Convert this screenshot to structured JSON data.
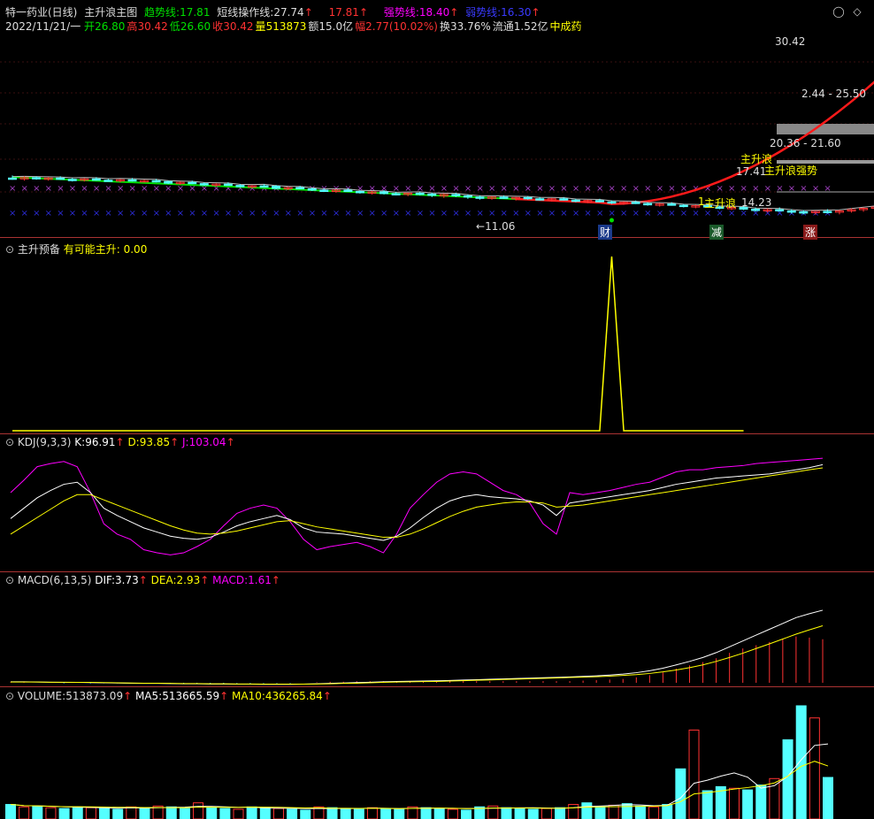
{
  "window": {
    "title": "特一药业(日线)",
    "indicator_name": "主升浪主图",
    "trend_label": "趋势线:",
    "trend_value": "17.81",
    "short_label": "短线操作线:",
    "short_value": "27.74",
    "short_value2": "17.81",
    "strong_label": "强势线:",
    "strong_value": "18.40",
    "weak_label": "弱势线:",
    "weak_value": "16.30",
    "arrow": "↑"
  },
  "quote": {
    "date": "2022/11/21/一",
    "open_label": "开",
    "open": "26.80",
    "high_label": "高",
    "high": "30.42",
    "low_label": "低",
    "low": "26.60",
    "close_label": "收",
    "close": "30.42",
    "volume_label": "量",
    "volume": "513873",
    "amount_label": "额",
    "amount": "15.0亿",
    "change_label": "幅",
    "change": "2.77(10.02%)",
    "turnover_label": "换",
    "turnover": "33.76%",
    "float_label": "流通",
    "float_value": "1.52亿",
    "sector": "中成药"
  },
  "main_annotations": {
    "high_price": "30.42",
    "low_price": "11.06",
    "low_arrow": "←",
    "range1": "2.44 - 25.50",
    "range2": "20.36 - 21.60",
    "price_1741": "17.41",
    "price_1423": "14.23",
    "label_zsl": "主升浪",
    "label_zsl2": "主升浪",
    "label_strong": "主升浪强势",
    "digit_1": "1",
    "tag_cai": "财",
    "tag_jian": "减",
    "tag_zhang": "涨"
  },
  "panel2": {
    "title": "主升预备",
    "label": "有可能主升:",
    "value": "0.00"
  },
  "panel3": {
    "title": "KDJ(9,3,3)",
    "k_label": "K:",
    "k_value": "96.91",
    "d_label": "D:",
    "d_value": "93.85",
    "j_label": "J:",
    "j_value": "103.04"
  },
  "panel4": {
    "title": "MACD(6,13,5)",
    "dif_label": "DIF:",
    "dif_value": "3.73",
    "dea_label": "DEA:",
    "dea_value": "2.93",
    "macd_label": "MACD:",
    "macd_value": "1.61"
  },
  "panel5": {
    "title": "VOLUME:",
    "vol_value": "513873.09",
    "ma5_label": "MA5:",
    "ma5_value": "513665.59",
    "ma10_label": "MA10:",
    "ma10_value": "436265.84"
  },
  "colors": {
    "up": "#ff3232",
    "down": "#54ffff",
    "magenta": "#ff00ff",
    "yellow": "#ffff00",
    "green": "#00e000",
    "trend_red": "#ff1a1a",
    "blue_x": "#2b2bd6",
    "purple_x": "#a040c0",
    "white": "#ffffff",
    "separator": "#aa3333"
  },
  "chart_data": {
    "type": "candlestick",
    "note_icons": [
      "minimize-icon",
      "maximize-icon"
    ],
    "candles": [
      {
        "o": 15.3,
        "h": 15.6,
        "l": 15.1,
        "c": 15.25
      },
      {
        "o": 15.25,
        "h": 15.5,
        "l": 15.0,
        "c": 15.35
      },
      {
        "o": 15.35,
        "h": 15.5,
        "l": 15.1,
        "c": 15.2
      },
      {
        "o": 15.2,
        "h": 15.4,
        "l": 15.0,
        "c": 15.3
      },
      {
        "o": 15.3,
        "h": 15.5,
        "l": 15.1,
        "c": 15.15
      },
      {
        "o": 15.15,
        "h": 15.3,
        "l": 14.9,
        "c": 15.1
      },
      {
        "o": 15.1,
        "h": 15.3,
        "l": 14.9,
        "c": 15.2
      },
      {
        "o": 15.2,
        "h": 15.4,
        "l": 15.0,
        "c": 15.05
      },
      {
        "o": 15.05,
        "h": 15.2,
        "l": 14.9,
        "c": 15.0
      },
      {
        "o": 15.0,
        "h": 15.2,
        "l": 14.8,
        "c": 15.1
      },
      {
        "o": 15.1,
        "h": 15.3,
        "l": 14.9,
        "c": 14.95
      },
      {
        "o": 14.95,
        "h": 15.1,
        "l": 14.8,
        "c": 15.0
      },
      {
        "o": 15.0,
        "h": 15.2,
        "l": 14.8,
        "c": 14.9
      },
      {
        "o": 14.9,
        "h": 15.0,
        "l": 14.6,
        "c": 14.7
      },
      {
        "o": 14.7,
        "h": 14.9,
        "l": 14.5,
        "c": 14.8
      },
      {
        "o": 14.8,
        "h": 15.0,
        "l": 14.6,
        "c": 14.65
      },
      {
        "o": 14.65,
        "h": 14.8,
        "l": 14.4,
        "c": 14.5
      },
      {
        "o": 14.5,
        "h": 14.7,
        "l": 14.3,
        "c": 14.6
      },
      {
        "o": 14.6,
        "h": 14.8,
        "l": 14.4,
        "c": 14.45
      },
      {
        "o": 14.45,
        "h": 14.6,
        "l": 14.2,
        "c": 14.3
      },
      {
        "o": 14.3,
        "h": 14.5,
        "l": 14.1,
        "c": 14.4
      },
      {
        "o": 14.4,
        "h": 14.6,
        "l": 14.2,
        "c": 14.35
      },
      {
        "o": 14.35,
        "h": 14.5,
        "l": 14.0,
        "c": 14.1
      },
      {
        "o": 14.1,
        "h": 14.3,
        "l": 13.9,
        "c": 14.2
      },
      {
        "o": 14.2,
        "h": 14.4,
        "l": 14.0,
        "c": 14.05
      },
      {
        "o": 14.05,
        "h": 14.2,
        "l": 13.8,
        "c": 13.9
      },
      {
        "o": 13.9,
        "h": 14.1,
        "l": 13.7,
        "c": 13.8
      },
      {
        "o": 13.8,
        "h": 14.0,
        "l": 13.6,
        "c": 13.9
      },
      {
        "o": 13.9,
        "h": 14.1,
        "l": 13.7,
        "c": 13.75
      },
      {
        "o": 13.75,
        "h": 13.9,
        "l": 13.5,
        "c": 13.6
      },
      {
        "o": 13.6,
        "h": 13.8,
        "l": 13.4,
        "c": 13.7
      },
      {
        "o": 13.7,
        "h": 13.9,
        "l": 13.4,
        "c": 13.5
      },
      {
        "o": 13.5,
        "h": 13.7,
        "l": 13.3,
        "c": 13.4
      },
      {
        "o": 13.4,
        "h": 13.6,
        "l": 13.2,
        "c": 13.55
      },
      {
        "o": 13.55,
        "h": 13.7,
        "l": 13.3,
        "c": 13.45
      },
      {
        "o": 13.45,
        "h": 13.6,
        "l": 13.1,
        "c": 13.3
      },
      {
        "o": 13.3,
        "h": 13.5,
        "l": 13.0,
        "c": 13.4
      },
      {
        "o": 13.4,
        "h": 13.6,
        "l": 13.1,
        "c": 13.25
      },
      {
        "o": 13.25,
        "h": 13.4,
        "l": 12.9,
        "c": 13.1
      },
      {
        "o": 13.1,
        "h": 13.3,
        "l": 12.8,
        "c": 13.0
      },
      {
        "o": 13.0,
        "h": 13.2,
        "l": 12.8,
        "c": 13.1
      },
      {
        "o": 13.1,
        "h": 13.3,
        "l": 12.9,
        "c": 12.95
      },
      {
        "o": 12.95,
        "h": 13.1,
        "l": 12.7,
        "c": 13.05
      },
      {
        "o": 13.05,
        "h": 13.2,
        "l": 12.8,
        "c": 12.9
      },
      {
        "o": 12.9,
        "h": 13.1,
        "l": 12.7,
        "c": 12.8
      },
      {
        "o": 12.8,
        "h": 13.0,
        "l": 12.6,
        "c": 12.9
      },
      {
        "o": 12.9,
        "h": 13.1,
        "l": 12.7,
        "c": 12.75
      },
      {
        "o": 12.75,
        "h": 12.9,
        "l": 12.5,
        "c": 12.6
      },
      {
        "o": 12.6,
        "h": 12.8,
        "l": 12.4,
        "c": 12.7
      },
      {
        "o": 12.7,
        "h": 12.9,
        "l": 12.5,
        "c": 12.55
      },
      {
        "o": 12.55,
        "h": 12.7,
        "l": 12.3,
        "c": 12.4
      },
      {
        "o": 12.4,
        "h": 12.6,
        "l": 12.2,
        "c": 12.5
      },
      {
        "o": 12.5,
        "h": 12.7,
        "l": 12.3,
        "c": 12.35
      },
      {
        "o": 12.35,
        "h": 12.5,
        "l": 12.1,
        "c": 12.2
      },
      {
        "o": 12.2,
        "h": 12.4,
        "l": 12.0,
        "c": 12.3
      },
      {
        "o": 12.3,
        "h": 12.5,
        "l": 12.1,
        "c": 12.15
      },
      {
        "o": 12.15,
        "h": 12.3,
        "l": 11.9,
        "c": 12.0
      },
      {
        "o": 12.0,
        "h": 12.2,
        "l": 11.8,
        "c": 12.1
      },
      {
        "o": 12.1,
        "h": 12.3,
        "l": 11.9,
        "c": 11.95
      },
      {
        "o": 11.95,
        "h": 12.1,
        "l": 11.7,
        "c": 11.8
      },
      {
        "o": 11.8,
        "h": 12.0,
        "l": 11.6,
        "c": 11.9
      },
      {
        "o": 11.9,
        "h": 12.1,
        "l": 11.6,
        "c": 11.7
      },
      {
        "o": 11.7,
        "h": 11.9,
        "l": 11.4,
        "c": 11.55
      },
      {
        "o": 11.55,
        "h": 11.8,
        "l": 11.3,
        "c": 11.65
      },
      {
        "o": 11.65,
        "h": 11.9,
        "l": 11.4,
        "c": 11.5
      },
      {
        "o": 11.5,
        "h": 11.7,
        "l": 11.2,
        "c": 11.4
      },
      {
        "o": 11.4,
        "h": 11.6,
        "l": 11.1,
        "c": 11.3
      },
      {
        "o": 11.3,
        "h": 11.5,
        "l": 11.06,
        "c": 11.45
      },
      {
        "o": 11.45,
        "h": 11.7,
        "l": 11.2,
        "c": 11.35
      },
      {
        "o": 11.35,
        "h": 11.6,
        "l": 11.1,
        "c": 11.5
      },
      {
        "o": 11.5,
        "h": 11.8,
        "l": 11.3,
        "c": 11.65
      },
      {
        "o": 11.65,
        "h": 11.9,
        "l": 11.4,
        "c": 11.8
      },
      {
        "o": 11.8,
        "h": 12.1,
        "l": 11.6,
        "c": 11.95
      },
      {
        "o": 11.95,
        "h": 12.2,
        "l": 11.7,
        "c": 12.1
      },
      {
        "o": 12.1,
        "h": 12.3,
        "l": 11.9,
        "c": 12.2
      },
      {
        "o": 12.2,
        "h": 12.4,
        "l": 12.0,
        "c": 12.3
      },
      {
        "o": 12.3,
        "h": 12.5,
        "l": 12.1,
        "c": 12.25
      },
      {
        "o": 12.25,
        "h": 12.4,
        "l": 12.0,
        "c": 12.35
      },
      {
        "o": 12.35,
        "h": 12.6,
        "l": 12.1,
        "c": 12.5
      },
      {
        "o": 12.5,
        "h": 12.7,
        "l": 12.3,
        "c": 12.45
      },
      {
        "o": 12.45,
        "h": 12.6,
        "l": 12.2,
        "c": 12.35
      },
      {
        "o": 12.35,
        "h": 12.5,
        "l": 12.1,
        "c": 12.4
      },
      {
        "o": 12.4,
        "h": 12.6,
        "l": 12.2,
        "c": 12.3
      },
      {
        "o": 12.3,
        "h": 12.5,
        "l": 12.1,
        "c": 12.45
      },
      {
        "o": 12.45,
        "h": 12.6,
        "l": 12.2,
        "c": 12.3
      },
      {
        "o": 12.3,
        "h": 12.4,
        "l": 12.0,
        "c": 12.2
      },
      {
        "o": 12.2,
        "h": 13.4,
        "l": 12.1,
        "c": 13.35
      },
      {
        "o": 13.35,
        "h": 13.6,
        "l": 13.0,
        "c": 13.2
      },
      {
        "o": 13.2,
        "h": 13.5,
        "l": 13.0,
        "c": 13.4
      },
      {
        "o": 13.4,
        "h": 13.6,
        "l": 13.1,
        "c": 13.3
      },
      {
        "o": 13.3,
        "h": 13.6,
        "l": 13.1,
        "c": 13.55
      },
      {
        "o": 13.55,
        "h": 13.8,
        "l": 13.3,
        "c": 13.65
      },
      {
        "o": 13.65,
        "h": 13.9,
        "l": 13.4,
        "c": 13.8
      },
      {
        "o": 13.8,
        "h": 14.0,
        "l": 13.6,
        "c": 13.95
      },
      {
        "o": 13.95,
        "h": 14.2,
        "l": 13.7,
        "c": 14.1
      },
      {
        "o": 14.1,
        "h": 14.4,
        "l": 13.9,
        "c": 14.3
      },
      {
        "o": 14.3,
        "h": 14.5,
        "l": 14.0,
        "c": 14.45
      },
      {
        "o": 14.45,
        "h": 14.7,
        "l": 14.2,
        "c": 14.6
      },
      {
        "o": 14.6,
        "h": 15.8,
        "l": 14.5,
        "c": 15.7
      },
      {
        "o": 15.7,
        "h": 16.2,
        "l": 15.4,
        "c": 16.0
      },
      {
        "o": 16.0,
        "h": 17.5,
        "l": 15.9,
        "c": 17.41
      },
      {
        "o": 17.41,
        "h": 19.2,
        "l": 17.3,
        "c": 19.1
      },
      {
        "o": 19.1,
        "h": 21.3,
        "l": 18.9,
        "c": 21.0
      },
      {
        "o": 21.0,
        "h": 21.9,
        "l": 19.0,
        "c": 19.3
      },
      {
        "o": 19.3,
        "h": 21.2,
        "l": 19.2,
        "c": 20.9
      },
      {
        "o": 20.9,
        "h": 23.2,
        "l": 20.36,
        "c": 22.8
      },
      {
        "o": 22.8,
        "h": 24.6,
        "l": 22.3,
        "c": 23.4
      },
      {
        "o": 23.4,
        "h": 25.3,
        "l": 22.6,
        "c": 24.9
      },
      {
        "o": 24.9,
        "h": 25.6,
        "l": 23.0,
        "c": 23.8
      },
      {
        "o": 25.5,
        "h": 27.8,
        "l": 25.3,
        "c": 27.65
      },
      {
        "o": 26.8,
        "h": 30.42,
        "l": 26.6,
        "c": 30.42
      }
    ],
    "price_range": [
      9.5,
      32.0
    ],
    "kdj": {
      "K": [
        45,
        55,
        65,
        72,
        78,
        80,
        70,
        55,
        48,
        42,
        36,
        32,
        28,
        26,
        25,
        27,
        32,
        38,
        42,
        45,
        48,
        44,
        36,
        32,
        31,
        30,
        28,
        26,
        24,
        28,
        36,
        46,
        55,
        62,
        66,
        68,
        66,
        65,
        64,
        62,
        58,
        48,
        60,
        62,
        64,
        66,
        68,
        70,
        72,
        75,
        78,
        80,
        82,
        84,
        85,
        86,
        87,
        88,
        90,
        92,
        94,
        96.91
      ],
      "D": [
        30,
        38,
        46,
        54,
        62,
        68,
        68,
        63,
        58,
        53,
        48,
        43,
        38,
        34,
        31,
        30,
        31,
        33,
        36,
        39,
        42,
        43,
        40,
        37,
        35,
        33,
        31,
        29,
        27,
        27,
        30,
        35,
        41,
        47,
        52,
        56,
        58,
        60,
        61,
        61,
        60,
        56,
        57,
        58,
        60,
        62,
        64,
        66,
        68,
        70,
        72,
        74,
        76,
        78,
        80,
        82,
        84,
        86,
        88,
        90,
        92,
        93.85
      ],
      "J": [
        70,
        82,
        95,
        98,
        100,
        95,
        70,
        40,
        30,
        25,
        15,
        12,
        10,
        12,
        18,
        25,
        38,
        50,
        55,
        58,
        55,
        42,
        25,
        15,
        18,
        20,
        22,
        18,
        12,
        30,
        55,
        68,
        80,
        88,
        90,
        88,
        80,
        72,
        68,
        60,
        40,
        30,
        70,
        68,
        70,
        72,
        75,
        78,
        80,
        85,
        90,
        92,
        92,
        94,
        95,
        96,
        98,
        99,
        100,
        101,
        102,
        103.04
      ]
    },
    "macd": {
      "DIF": [
        0.05,
        0.05,
        0.04,
        0.03,
        0.02,
        0.02,
        0.01,
        0.0,
        -0.01,
        -0.02,
        -0.03,
        -0.03,
        -0.04,
        -0.05,
        -0.05,
        -0.06,
        -0.06,
        -0.07,
        -0.07,
        -0.08,
        -0.08,
        -0.08,
        -0.07,
        -0.05,
        -0.03,
        -0.01,
        0.01,
        0.03,
        0.05,
        0.07,
        0.08,
        0.09,
        0.1,
        0.12,
        0.14,
        0.16,
        0.18,
        0.2,
        0.22,
        0.24,
        0.26,
        0.28,
        0.3,
        0.33,
        0.36,
        0.4,
        0.45,
        0.52,
        0.62,
        0.75,
        0.92,
        1.1,
        1.3,
        1.55,
        1.85,
        2.15,
        2.45,
        2.75,
        3.05,
        3.35,
        3.55,
        3.73
      ],
      "DEA": [
        0.04,
        0.04,
        0.04,
        0.03,
        0.03,
        0.02,
        0.02,
        0.01,
        0.0,
        -0.01,
        -0.02,
        -0.02,
        -0.03,
        -0.04,
        -0.04,
        -0.05,
        -0.05,
        -0.06,
        -0.06,
        -0.07,
        -0.07,
        -0.07,
        -0.07,
        -0.06,
        -0.05,
        -0.03,
        -0.02,
        0.0,
        0.02,
        0.04,
        0.05,
        0.06,
        0.07,
        0.09,
        0.11,
        0.13,
        0.15,
        0.17,
        0.19,
        0.21,
        0.23,
        0.25,
        0.27,
        0.29,
        0.31,
        0.34,
        0.38,
        0.42,
        0.48,
        0.56,
        0.66,
        0.78,
        0.92,
        1.1,
        1.3,
        1.52,
        1.76,
        2.0,
        2.25,
        2.5,
        2.72,
        2.93
      ]
    },
    "volume": [
      180,
      150,
      160,
      140,
      130,
      150,
      140,
      130,
      120,
      150,
      140,
      160,
      150,
      130,
      200,
      140,
      130,
      120,
      150,
      140,
      130,
      120,
      110,
      150,
      140,
      130,
      120,
      140,
      130,
      120,
      150,
      140,
      130,
      120,
      110,
      150,
      160,
      140,
      130,
      120,
      130,
      140,
      180,
      200,
      150,
      170,
      190,
      160,
      150,
      180,
      620,
      1100,
      350,
      400,
      380,
      360,
      420,
      500,
      980,
      1400,
      1250,
      513.873
    ],
    "main_signal": [
      0,
      0,
      0,
      0,
      0,
      0,
      0,
      0,
      0,
      0,
      0,
      0,
      0,
      0,
      0,
      0,
      0,
      0,
      0,
      0,
      0,
      0,
      0,
      0,
      0,
      0,
      0,
      0,
      0,
      0,
      0,
      0,
      0,
      0,
      0,
      0,
      0,
      0,
      0,
      0,
      0,
      0,
      0,
      0,
      0,
      0,
      0,
      0,
      0,
      0,
      1,
      0,
      0,
      0,
      0,
      0,
      0,
      0,
      0,
      0,
      0,
      0
    ]
  }
}
